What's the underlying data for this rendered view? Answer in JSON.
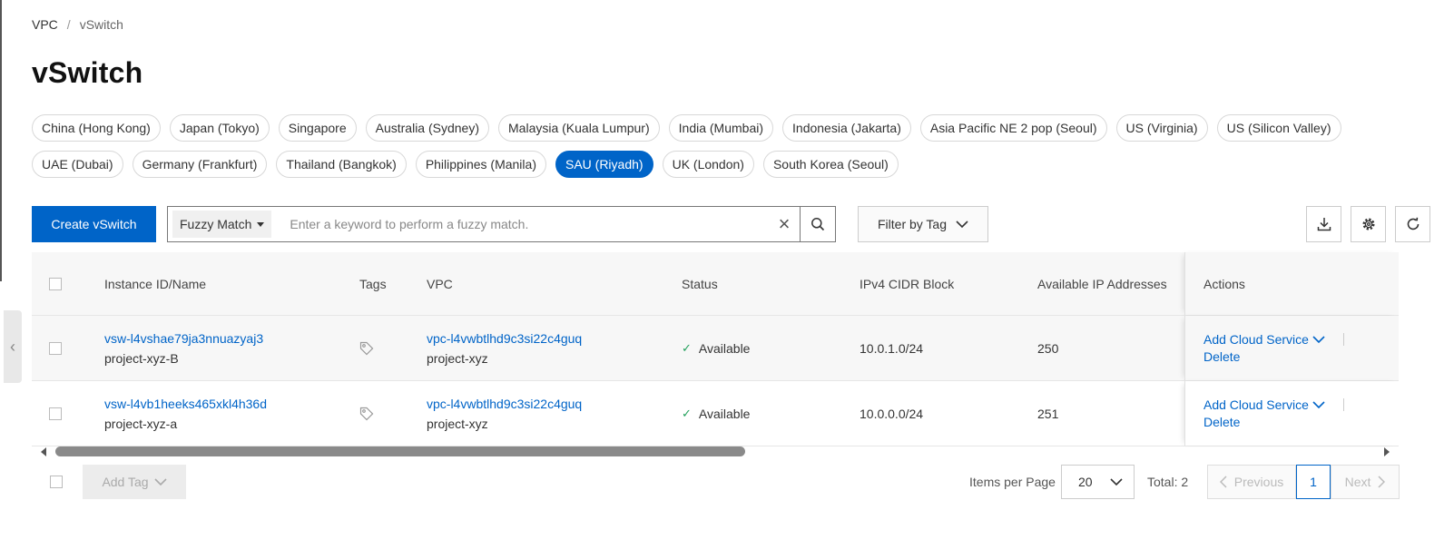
{
  "breadcrumb": {
    "root": "VPC",
    "sep": "/",
    "current": "vSwitch"
  },
  "page_title": "vSwitch",
  "regions": [
    {
      "label": "China (Hong Kong)",
      "active": false
    },
    {
      "label": "Japan (Tokyo)",
      "active": false
    },
    {
      "label": "Singapore",
      "active": false
    },
    {
      "label": "Australia (Sydney)",
      "active": false
    },
    {
      "label": "Malaysia (Kuala Lumpur)",
      "active": false
    },
    {
      "label": "India (Mumbai)",
      "active": false
    },
    {
      "label": "Indonesia (Jakarta)",
      "active": false
    },
    {
      "label": "Asia Pacific NE 2 pop (Seoul)",
      "active": false
    },
    {
      "label": "US (Virginia)",
      "active": false
    },
    {
      "label": "US (Silicon Valley)",
      "active": false
    },
    {
      "label": "UAE (Dubai)",
      "active": false
    },
    {
      "label": "Germany (Frankfurt)",
      "active": false
    },
    {
      "label": "Thailand (Bangkok)",
      "active": false
    },
    {
      "label": "Philippines (Manila)",
      "active": false
    },
    {
      "label": "SAU (Riyadh)",
      "active": true
    },
    {
      "label": "UK (London)",
      "active": false
    },
    {
      "label": "South Korea (Seoul)",
      "active": false
    }
  ],
  "toolbar": {
    "create_label": "Create vSwitch",
    "match_mode": "Fuzzy Match",
    "search_placeholder": "Enter a keyword to perform a fuzzy match.",
    "filter_by_tag": "Filter by Tag"
  },
  "table": {
    "headers": {
      "instance": "Instance ID/Name",
      "tags": "Tags",
      "vpc": "VPC",
      "status": "Status",
      "cidr": "IPv4 CIDR Block",
      "available_ips": "Available IP Addresses",
      "actions": "Actions"
    },
    "rows": [
      {
        "id": "vsw-l4vshae79ja3nnuazyaj3",
        "name": "project-xyz-B",
        "vpc_id": "vpc-l4vwbtlhd9c3si22c4guq",
        "vpc_name": "project-xyz",
        "status": "Available",
        "cidr": "10.0.1.0/24",
        "available_ips": "250",
        "action_add": "Add Cloud Service",
        "action_delete": "Delete"
      },
      {
        "id": "vsw-l4vb1heeks465xkl4h36d",
        "name": "project-xyz-a",
        "vpc_id": "vpc-l4vwbtlhd9c3si22c4guq",
        "vpc_name": "project-xyz",
        "status": "Available",
        "cidr": "10.0.0.0/24",
        "available_ips": "251",
        "action_add": "Add Cloud Service",
        "action_delete": "Delete"
      }
    ]
  },
  "footer": {
    "add_tag": "Add Tag",
    "items_per_page_label": "Items per Page",
    "items_per_page": "20",
    "total": "Total: 2",
    "previous": "Previous",
    "current_page": "1",
    "next": "Next"
  },
  "colors": {
    "primary": "#0064c8",
    "status_ok": "#23a15c"
  }
}
